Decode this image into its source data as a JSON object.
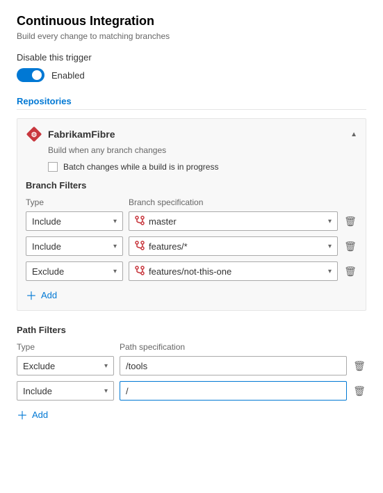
{
  "page": {
    "title": "Continuous Integration",
    "subtitle": "Build every change to matching branches"
  },
  "trigger": {
    "disable_label": "Disable this trigger",
    "toggle_state": "Enabled",
    "enabled": true
  },
  "repositories_section": {
    "label": "Repositories"
  },
  "repo": {
    "name": "FabrikamFibre",
    "description": "Build when any branch changes",
    "batch_label": "Batch changes while a build is in progress"
  },
  "branch_filters": {
    "title": "Branch Filters",
    "col_type": "Type",
    "col_spec": "Branch specification",
    "rows": [
      {
        "type": "Include",
        "spec": "master"
      },
      {
        "type": "Include",
        "spec": "features/*"
      },
      {
        "type": "Exclude",
        "spec": "features/not-this-one"
      }
    ],
    "add_label": "Add"
  },
  "path_filters": {
    "title": "Path Filters",
    "col_type": "Type",
    "col_spec": "Path specification",
    "rows": [
      {
        "type": "Exclude",
        "spec": "/tools"
      },
      {
        "type": "Include",
        "spec": "/"
      }
    ],
    "add_label": "Add"
  }
}
